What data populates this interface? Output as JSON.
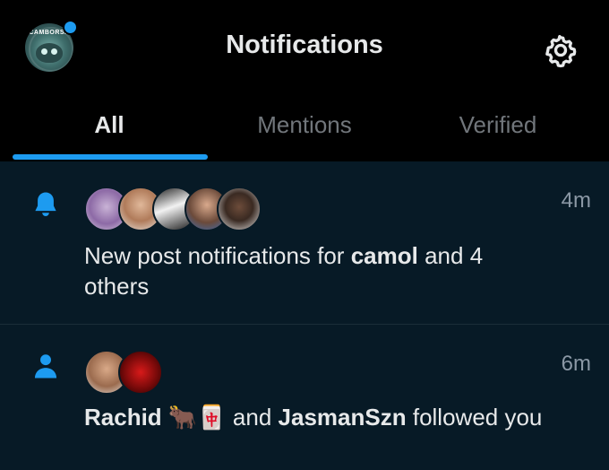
{
  "header": {
    "title": "Notifications",
    "profile_badge_text": "CAMBORSA",
    "accent_color": "#1d9bf0"
  },
  "tabs": [
    {
      "label": "All",
      "active": true
    },
    {
      "label": "Mentions",
      "active": false
    },
    {
      "label": "Verified",
      "active": false
    }
  ],
  "notifications": [
    {
      "type": "new-post",
      "icon": "bell-icon",
      "time": "4m",
      "text_prefix": "New post notifications for",
      "bold_name": "camol",
      "text_suffix": "and 4",
      "text_line2": "others",
      "avatars": 5
    },
    {
      "type": "follow",
      "icon": "person-icon",
      "time": "6m",
      "bold_name_1": "Rachid",
      "emoji": "🐂🀄",
      "middle": "and",
      "bold_name_2": "JasmanSzn",
      "suffix": "followed you",
      "avatars": 2
    }
  ]
}
